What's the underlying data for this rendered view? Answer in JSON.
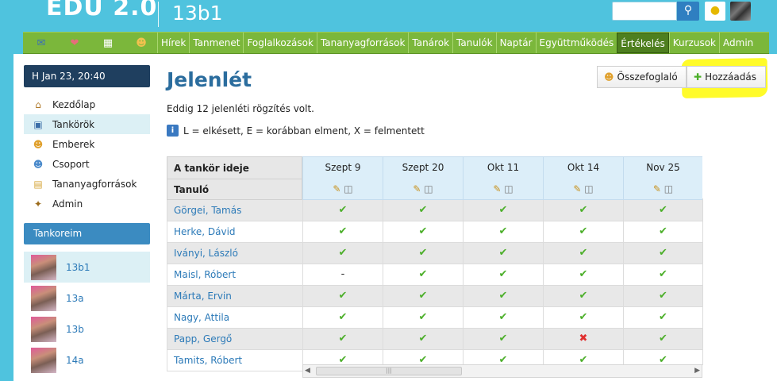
{
  "header": {
    "logo": "EDU 2.0",
    "course_title": "13b1",
    "search_icon": "search-icon",
    "bulb_icon": "lightbulb-icon"
  },
  "nav": {
    "icons": [
      "mail-icon",
      "heart-icon",
      "calendar-icon",
      "users-icon"
    ],
    "items": [
      {
        "label": "Hírek"
      },
      {
        "label": "Tanmenet"
      },
      {
        "label": "Foglalkozások"
      },
      {
        "label": "Tananyagforrások"
      },
      {
        "label": "Tanárok"
      },
      {
        "label": "Tanulók"
      },
      {
        "label": "Naptár"
      },
      {
        "label": "Együttműködés"
      },
      {
        "label": "Értékelés"
      },
      {
        "label": "Kurzusok"
      },
      {
        "label": "Admin"
      }
    ],
    "active": "Értékelés"
  },
  "sidebar": {
    "date": "H Jan 23, 20:40",
    "menu": [
      {
        "label": "Kezdőlap",
        "icon": "home-icon"
      },
      {
        "label": "Tankörök",
        "icon": "book-icon"
      },
      {
        "label": "Emberek",
        "icon": "person-icon"
      },
      {
        "label": "Csoport",
        "icon": "group-icon"
      },
      {
        "label": "Tananyagforrások",
        "icon": "folder-icon"
      },
      {
        "label": "Admin",
        "icon": "wand-icon"
      }
    ],
    "my_courses_title": "Tankoreim",
    "courses": [
      {
        "name": "13b1"
      },
      {
        "name": "13a"
      },
      {
        "name": "13b"
      },
      {
        "name": "14a"
      }
    ]
  },
  "main": {
    "title": "Jelenlét",
    "summary_button": "Összefoglaló",
    "add_button": "Hozzáadás",
    "count_text": "Eddig 12 jelenléti rögzítés volt.",
    "legend_text": "L = elkésett, E = korábban elment, X = felmentett"
  },
  "table": {
    "header_left_1": "A tankör ideje",
    "header_left_2": "Tanuló",
    "dates": [
      "Szept 9",
      "Szept 20",
      "Okt 11",
      "Okt 14",
      "Nov 25"
    ],
    "students": [
      {
        "name": "Görgei, Tamás",
        "marks": [
          "check",
          "check",
          "check",
          "check",
          "check"
        ]
      },
      {
        "name": "Herke, Dávid",
        "marks": [
          "check",
          "check",
          "check",
          "check",
          "check"
        ]
      },
      {
        "name": "Iványi, László",
        "marks": [
          "check",
          "check",
          "check",
          "check",
          "check"
        ]
      },
      {
        "name": "Maisl, Róbert",
        "marks": [
          "-",
          "check",
          "check",
          "check",
          "check"
        ]
      },
      {
        "name": "Márta, Ervin",
        "marks": [
          "check",
          "check",
          "check",
          "check",
          "check"
        ]
      },
      {
        "name": "Nagy, Attila",
        "marks": [
          "check",
          "check",
          "check",
          "check",
          "check"
        ]
      },
      {
        "name": "Papp, Gergő",
        "marks": [
          "check",
          "check",
          "check",
          "x",
          "check"
        ]
      },
      {
        "name": "Tamits, Róbert",
        "marks": [
          "check",
          "check",
          "check",
          "check",
          "check"
        ]
      }
    ]
  },
  "colors": {
    "top_bg": "#4fc3de",
    "nav_green": "#7bb73b",
    "title_blue": "#2b6d9e",
    "link_blue": "#2c7ab8",
    "highlight_yellow": "#fffb2a"
  }
}
